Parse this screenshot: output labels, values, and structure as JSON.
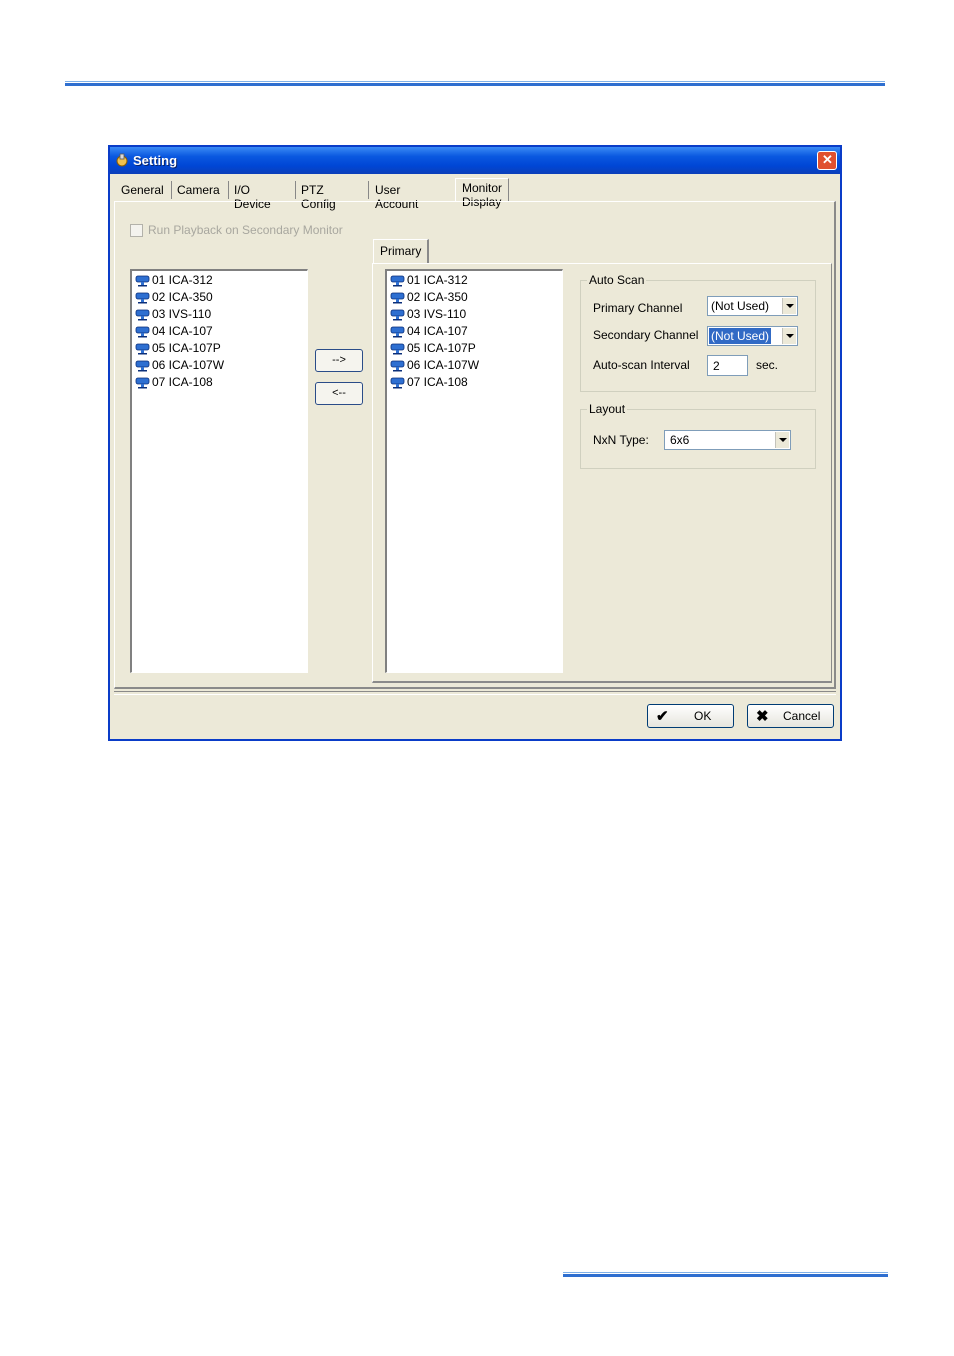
{
  "window": {
    "title": "Setting",
    "close_glyph": "✕"
  },
  "tabs": [
    {
      "label": "General"
    },
    {
      "label": "Camera"
    },
    {
      "label": "I/O Device"
    },
    {
      "label": "PTZ Config"
    },
    {
      "label": "User Account"
    },
    {
      "label": "Monitor Display",
      "active": true
    }
  ],
  "run_playback": {
    "label": "Run Playback on Secondary Monitor",
    "checked": false,
    "disabled": true
  },
  "available_cameras": [
    "01 ICA-312",
    "02 ICA-350",
    "03 IVS-110",
    "04 ICA-107",
    "05 ICA-107P",
    "06 ICA-107W",
    "07 ICA-108"
  ],
  "buttons": {
    "add": "-->",
    "remove": "<--",
    "ok": "OK",
    "cancel": "Cancel",
    "ok_glyph": "✔",
    "cancel_glyph": "✖"
  },
  "sub_tab": "Primary",
  "primary_cameras": [
    "01 ICA-312",
    "02 ICA-350",
    "03 IVS-110",
    "04 ICA-107",
    "05 ICA-107P",
    "06 ICA-107W",
    "07 ICA-108"
  ],
  "auto_scan": {
    "title": "Auto Scan",
    "primary_label": "Primary Channel",
    "primary_value": "(Not Used)",
    "secondary_label": "Secondary Channel",
    "secondary_value": "(Not Used)",
    "interval_label": "Auto-scan Interval",
    "interval_value": "2",
    "interval_unit": "sec."
  },
  "layout": {
    "title": "Layout",
    "nxn_label": "NxN Type:",
    "nxn_value": "6x6"
  },
  "colors": {
    "title_bar": "#0046d5",
    "dialog_bg": "#ece9d8",
    "selection": "#316ac5",
    "rule_blue": "#2f6fd0"
  },
  "icons": {
    "app": "setting-app-icon",
    "camera": "camera-icon"
  }
}
